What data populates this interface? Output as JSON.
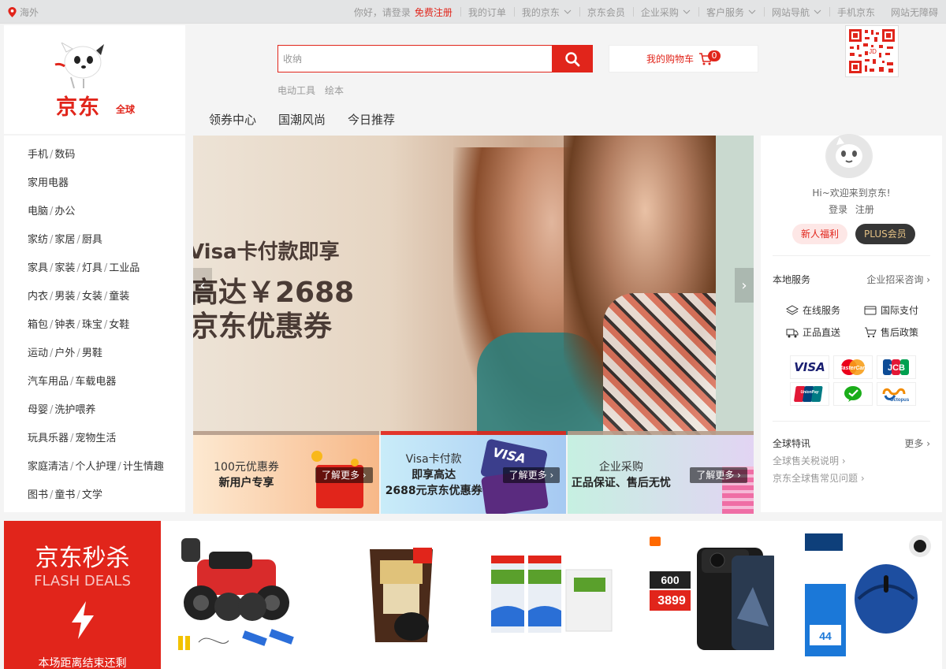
{
  "topbar": {
    "location": "海外",
    "greeting": "你好，请登录",
    "register": "免费注册",
    "links": [
      "我的订单",
      "我的京东",
      "京东会员",
      "企业采购",
      "客户服务",
      "网站导航",
      "手机京东",
      "网站无障碍"
    ]
  },
  "logo": {
    "brand": "京东",
    "sub": "全球"
  },
  "search": {
    "placeholder": "收纳",
    "hotwords": [
      "电动工具",
      "绘本"
    ]
  },
  "cart": {
    "label": "我的购物车",
    "count": "0"
  },
  "subnav": [
    "领券中心",
    "国潮风尚",
    "今日推荐"
  ],
  "categories": [
    [
      "手机",
      "数码"
    ],
    [
      "家用电器"
    ],
    [
      "电脑",
      "办公"
    ],
    [
      "家纺",
      "家居",
      "厨具"
    ],
    [
      "家具",
      "家装",
      "灯具",
      "工业品"
    ],
    [
      "内衣",
      "男装",
      "女装",
      "童装"
    ],
    [
      "箱包",
      "钟表",
      "珠宝",
      "女鞋"
    ],
    [
      "运动",
      "户外",
      "男鞋"
    ],
    [
      "汽车用品",
      "车载电器"
    ],
    [
      "母婴",
      "洗护喂养"
    ],
    [
      "玩具乐器",
      "宠物生活"
    ],
    [
      "家庭清洁",
      "个人护理",
      "计生情趣"
    ],
    [
      "图书",
      "童书",
      "文学"
    ]
  ],
  "banner": {
    "line1": "Visa卡付款即享",
    "line2": "高达￥2688",
    "line3": "京东优惠券",
    "slide_count": 3,
    "active_slide": 2
  },
  "subbanners": [
    {
      "line1": "100元优惠券",
      "line2": "新用户专享",
      "line3": "",
      "more": "了解更多 ›"
    },
    {
      "line1": "Visa卡付款",
      "line2": "即享高达",
      "line3": "2688元京东优惠券",
      "more": "了解更多 ›"
    },
    {
      "line1": "企业采购",
      "line2": "正品保证、售后无忧",
      "line3": "",
      "more": "了解更多 ›"
    }
  ],
  "user": {
    "welcome": "Hi~欢迎来到京东!",
    "login": "登录",
    "register": "注册",
    "newbie": "新人福利",
    "plus": "PLUS会员"
  },
  "local": {
    "title": "本地服务",
    "link": "企业招采咨询 ›",
    "services": [
      "在线服务",
      "国际支付",
      "正品直送",
      "售后政策"
    ]
  },
  "payments": [
    "VISA",
    "MasterCard",
    "JCB",
    "UnionPay",
    "WeChat",
    "Octopus"
  ],
  "global": {
    "title": "全球特讯",
    "more": "更多 ›",
    "links": [
      "全球售关税说明 ›",
      "京东全球售常见问题 ›"
    ]
  },
  "flash": {
    "title": "京东秒杀",
    "en": "FLASH DEALS",
    "note": "本场距离结束还剩"
  },
  "products": [
    {
      "name": "遥控越野车",
      "icon": "rc-car"
    },
    {
      "name": "南方黑芝麻",
      "icon": "sesame-pack"
    },
    {
      "name": "纯牛奶",
      "icon": "milk-box"
    },
    {
      "name": "小米 11 Ultra",
      "icon": "phone",
      "price": "3899",
      "discount": "600"
    },
    {
      "name": "罗技 鼠标",
      "icon": "mouse",
      "price": "44"
    }
  ],
  "colors": {
    "brand_red": "#e1251b",
    "plus_gold": "#e4c184"
  }
}
